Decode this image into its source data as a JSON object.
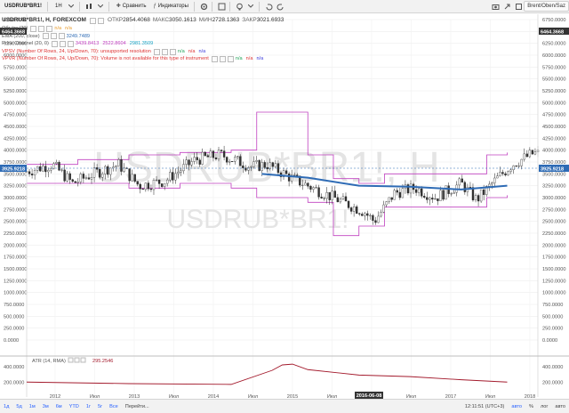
{
  "toolbar": {
    "symbol": "USDRUB*BR1!",
    "interval": "1H",
    "compare_label": "Сравнить",
    "indicators_label": "Индикаторы",
    "right_label": "Brent/Oben/Saz"
  },
  "header": {
    "title": "USDRUB*BR1!, H, FOREXCOM",
    "open_label": "ОТКР",
    "open": "2854.4068",
    "high_label": "МАКС",
    "high": "3050.1613",
    "low_label": "МИН",
    "low": "2728.1363",
    "close_label": "ЗАКР",
    "close": "3021.6933"
  },
  "legend": [
    {
      "name": "Объём (20)",
      "values": [
        "n/a",
        "n/a"
      ],
      "colors": [
        "#e89b2a",
        "#e89b2a"
      ]
    },
    {
      "name": "EMA (200, close)",
      "values": [
        "3249.7489"
      ],
      "colors": [
        "#2e6bb5"
      ]
    },
    {
      "name": "Price Channel (20, 0)",
      "values": [
        "3439.8413",
        "2522.8604",
        "2981.3509"
      ],
      "colors": [
        "#c040c0",
        "#c040c0",
        "#17a2c4"
      ]
    },
    {
      "name": "VPSV (Number Of Rows, 24, Up/Down, 70): unsupported resolution",
      "values": [
        "n/a",
        "n/a",
        "n/a"
      ],
      "colors": [
        "#22a35a",
        "#d33",
        "#3a3adb"
      ],
      "red": true
    },
    {
      "name": "VPVR (Number Of Rows, 24, Up/Down, 70): Volume is not available for this type of instrument",
      "values": [
        "n/a",
        "n/a",
        "n/a"
      ],
      "colors": [
        "#22a35a",
        "#d33",
        "#3a3adb"
      ],
      "red": true
    }
  ],
  "watermark": {
    "line1": "USDRUB*BR1!, H",
    "line2": "USDRUB*BR1!"
  },
  "price_axis": {
    "labels": [
      "6750.0000",
      "6500.0000",
      "6250.0000",
      "6000.0000",
      "5750.0000",
      "5500.0000",
      "5250.0000",
      "5000.0000",
      "4750.0000",
      "4500.0000",
      "4250.0000",
      "4000.0000",
      "3750.0000",
      "3500.0000",
      "3250.0000",
      "3000.0000",
      "2750.0000",
      "2500.0000",
      "2250.0000",
      "2000.0000",
      "1750.0000",
      "1500.0000",
      "1250.0000",
      "1000.0000",
      "750.0000",
      "500.0000",
      "250.0000",
      "0.0000"
    ],
    "badge_top": "6464.3668",
    "badge_current": "3925.9218",
    "badge_current_color": "#2e6bb5"
  },
  "atr": {
    "name": "ATR (14, RMA)",
    "value": "295.2546",
    "axis_labels": [
      "400.0000",
      "200.0000"
    ],
    "color": "#a31a2c"
  },
  "time_axis": {
    "labels": [
      "2012",
      "Июл",
      "2013",
      "Июл",
      "2014",
      "Июл",
      "2015",
      "Июл",
      "2016",
      "Июл",
      "2017",
      "Июл",
      "2018"
    ],
    "highlight": "2016-06-08"
  },
  "bottom_bar": {
    "periods": [
      "1д",
      "5д",
      "1м",
      "3м",
      "6м",
      "YTD",
      "1г",
      "5г",
      "Все"
    ],
    "goto": "Перейти...",
    "time": "12:11:51 (UTC+3)",
    "modes": [
      "авто",
      "%",
      "лог",
      "авто"
    ]
  },
  "chart_data": {
    "type": "candlestick",
    "ylim": [
      0,
      6750
    ],
    "series": [
      {
        "name": "EMA (200, close)",
        "x": [
          0.46,
          0.55,
          0.65,
          0.75,
          0.85,
          0.94
        ],
        "y": [
          3500,
          3420,
          3250,
          3230,
          3170,
          3250
        ]
      },
      {
        "name": "Price Channel upper",
        "x": [
          0.0,
          0.1,
          0.2,
          0.3,
          0.4,
          0.45,
          0.5,
          0.55,
          0.6,
          0.65,
          0.7,
          0.8,
          0.9,
          0.94
        ],
        "y": [
          3700,
          3800,
          3900,
          3950,
          4000,
          4800,
          4800,
          3900,
          3400,
          3300,
          3500,
          3500,
          3900,
          3950
        ]
      },
      {
        "name": "Price Channel lower",
        "x": [
          0.0,
          0.1,
          0.2,
          0.3,
          0.4,
          0.45,
          0.5,
          0.55,
          0.6,
          0.65,
          0.7,
          0.8,
          0.9,
          0.94
        ],
        "y": [
          3300,
          3300,
          3200,
          3300,
          3200,
          3000,
          3000,
          2900,
          2200,
          2400,
          2800,
          2800,
          3000,
          3050
        ]
      },
      {
        "name": "ATR (14, RMA)",
        "x": [
          0.0,
          0.2,
          0.4,
          0.48,
          0.5,
          0.52,
          0.55,
          0.65,
          0.75,
          0.85,
          0.94
        ],
        "y": [
          200,
          180,
          170,
          350,
          420,
          430,
          360,
          290,
          270,
          230,
          200
        ]
      }
    ],
    "last_price": 3925.92
  }
}
